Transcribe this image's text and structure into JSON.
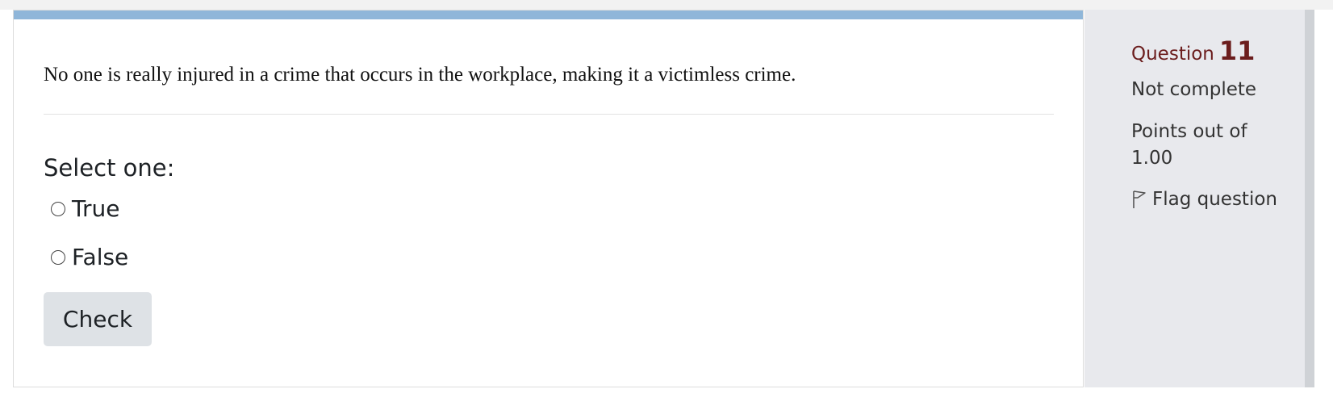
{
  "question": {
    "text": "No one is really injured in a crime that occurs in the workplace, making it a victimless crime.",
    "prompt": "Select one:",
    "options": [
      {
        "label": "True",
        "selected": false
      },
      {
        "label": "False",
        "selected": false
      }
    ],
    "check_label": "Check"
  },
  "info": {
    "question_word": "Question",
    "question_number": "11",
    "state": "Not complete",
    "grade": "Points out of 1.00",
    "flag_label": "Flag question",
    "flag_icon": "flag-outline-icon"
  },
  "colors": {
    "top_bar": "#8fb6d9",
    "question_number": "#6b1d1d",
    "sidebar_bg": "#e8e9ed",
    "button_bg": "#dee2e6"
  }
}
